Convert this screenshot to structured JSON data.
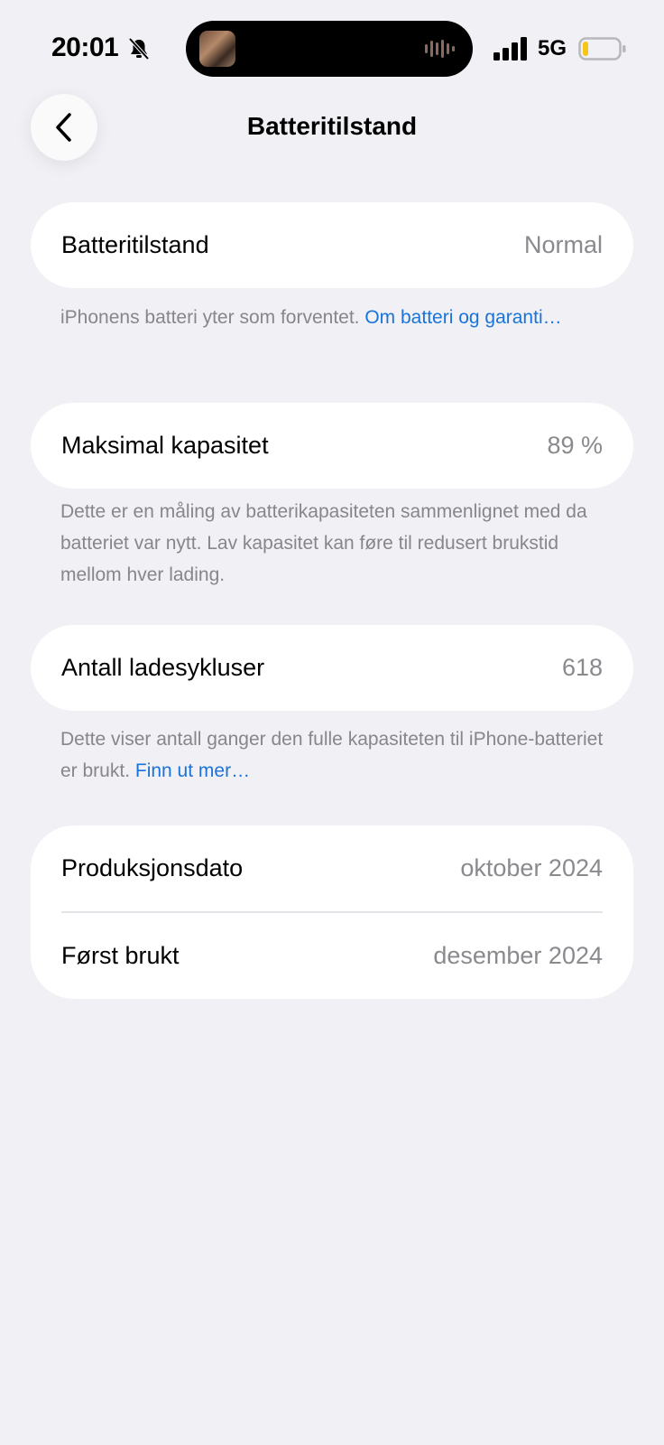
{
  "status_bar": {
    "time": "20:01",
    "network": "5G",
    "battery_level": 0.12,
    "battery_color": "#f5c518",
    "icons": [
      "bell-slash-icon",
      "signal-icon",
      "battery-icon"
    ]
  },
  "nav": {
    "title": "Batteritilstand",
    "back_icon": "chevron-left-icon"
  },
  "battery_health": {
    "label": "Batteritilstand",
    "value": "Normal",
    "footnote_text": "iPhonens batteri yter som forventet. ",
    "footnote_link": "Om batteri og garanti…"
  },
  "max_capacity": {
    "label": "Maksimal kapasitet",
    "value": "89 %",
    "footnote_text": "Dette er en måling av batterikapasiteten sammenlignet med da batteriet var nytt. Lav kapasitet kan føre til redusert brukstid mellom hver lading."
  },
  "cycle_count": {
    "label": "Antall ladesykluser",
    "value": "618",
    "footnote_text": "Dette viser antall ganger den fulle kapasiteten til iPhone-batteriet er brukt. ",
    "footnote_link": "Finn ut mer…"
  },
  "dates": {
    "manufacture_label": "Produksjonsdato",
    "manufacture_value": "oktober 2024",
    "first_use_label": "Først brukt",
    "first_use_value": "desember 2024"
  },
  "colors": {
    "background": "#f0f0f5",
    "card": "#ffffff",
    "link": "#1a73d9",
    "secondary_text": "#8a8a8e"
  }
}
